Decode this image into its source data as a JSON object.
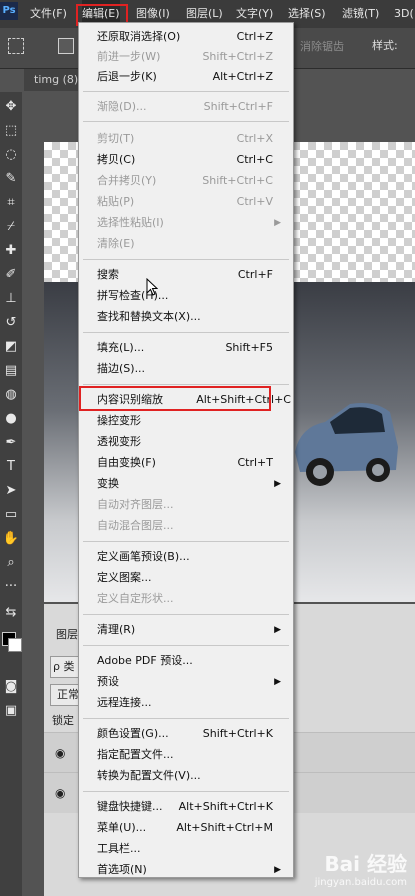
{
  "menubar": {
    "logo": "Ps",
    "items": [
      "文件(F)",
      "编辑(E)",
      "图像(I)",
      "图层(L)",
      "文字(Y)",
      "选择(S)",
      "滤镜(T)",
      "3D("
    ]
  },
  "options_bar": {
    "feather_dim": "消除锯齿",
    "style_label": "样式:"
  },
  "document": {
    "tab": "timg (8)"
  },
  "layers_panel": {
    "tab": "图层",
    "kind_prefix": "ρ 类",
    "blend_prefix": "正常",
    "lock_label": "锁定"
  },
  "watermark": {
    "main": "Bai 经验",
    "sub": "jingyan.baidu.com"
  },
  "edit_menu": {
    "items": [
      {
        "label": "还原取消选择(O)",
        "shortcut": "Ctrl+Z",
        "disabled": false
      },
      {
        "label": "前进一步(W)",
        "shortcut": "Shift+Ctrl+Z",
        "disabled": true
      },
      {
        "label": "后退一步(K)",
        "shortcut": "Alt+Ctrl+Z",
        "disabled": false
      },
      {
        "label": "渐隐(D)...",
        "shortcut": "Shift+Ctrl+F",
        "disabled": true
      },
      {
        "label": "剪切(T)",
        "shortcut": "Ctrl+X",
        "disabled": true
      },
      {
        "label": "拷贝(C)",
        "shortcut": "Ctrl+C",
        "disabled": false
      },
      {
        "label": "合并拷贝(Y)",
        "shortcut": "Shift+Ctrl+C",
        "disabled": true
      },
      {
        "label": "粘贴(P)",
        "shortcut": "Ctrl+V",
        "disabled": true
      },
      {
        "label": "选择性粘贴(I)",
        "shortcut": "",
        "disabled": true
      },
      {
        "label": "清除(E)",
        "shortcut": "",
        "disabled": true
      },
      {
        "label": "搜索",
        "shortcut": "Ctrl+F",
        "disabled": false
      },
      {
        "label": "拼写检查(H)...",
        "shortcut": "",
        "disabled": false
      },
      {
        "label": "查找和替换文本(X)...",
        "shortcut": "",
        "disabled": false
      },
      {
        "label": "填充(L)...",
        "shortcut": "Shift+F5",
        "disabled": false
      },
      {
        "label": "描边(S)...",
        "shortcut": "",
        "disabled": false
      },
      {
        "label": "内容识别缩放",
        "shortcut": "Alt+Shift+Ctrl+C",
        "disabled": false
      },
      {
        "label": "操控变形",
        "shortcut": "",
        "disabled": false
      },
      {
        "label": "透视变形",
        "shortcut": "",
        "disabled": false
      },
      {
        "label": "自由变换(F)",
        "shortcut": "Ctrl+T",
        "disabled": false
      },
      {
        "label": "变换",
        "shortcut": "",
        "disabled": false
      },
      {
        "label": "自动对齐图层...",
        "shortcut": "",
        "disabled": true
      },
      {
        "label": "自动混合图层...",
        "shortcut": "",
        "disabled": true
      },
      {
        "label": "定义画笔预设(B)...",
        "shortcut": "",
        "disabled": false
      },
      {
        "label": "定义图案...",
        "shortcut": "",
        "disabled": false
      },
      {
        "label": "定义自定形状...",
        "shortcut": "",
        "disabled": true
      },
      {
        "label": "清理(R)",
        "shortcut": "",
        "disabled": false
      },
      {
        "label": "Adobe PDF 预设...",
        "shortcut": "",
        "disabled": false
      },
      {
        "label": "预设",
        "shortcut": "",
        "disabled": false
      },
      {
        "label": "远程连接...",
        "shortcut": "",
        "disabled": false
      },
      {
        "label": "颜色设置(G)...",
        "shortcut": "Shift+Ctrl+K",
        "disabled": false
      },
      {
        "label": "指定配置文件...",
        "shortcut": "",
        "disabled": false
      },
      {
        "label": "转换为配置文件(V)...",
        "shortcut": "",
        "disabled": false
      },
      {
        "label": "键盘快捷键...",
        "shortcut": "Alt+Shift+Ctrl+K",
        "disabled": false
      },
      {
        "label": "菜单(U)...",
        "shortcut": "Alt+Shift+Ctrl+M",
        "disabled": false
      },
      {
        "label": "工具栏...",
        "shortcut": "",
        "disabled": false
      },
      {
        "label": "首选项(N)",
        "shortcut": "",
        "disabled": false
      }
    ],
    "submenu_arrow": "▶"
  }
}
